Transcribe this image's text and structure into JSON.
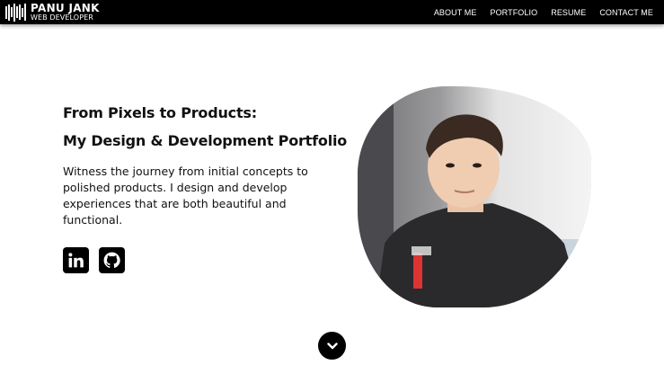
{
  "brand": {
    "name": "PANU JANK",
    "role": "WEB DEVELOPER",
    "logo_icon": "sound-bars-icon"
  },
  "nav": {
    "items": [
      {
        "label": "ABOUT ME"
      },
      {
        "label": "PORTFOLIO"
      },
      {
        "label": "RESUME"
      },
      {
        "label": "CONTACT ME"
      }
    ]
  },
  "hero": {
    "title_line1": "From Pixels to Products:",
    "title_line2": "My Design & Development Portfolio",
    "description": "Witness the journey from initial concepts to polished products. I design and develop experiences that are both beautiful and functional.",
    "social": [
      {
        "icon": "linkedin-icon"
      },
      {
        "icon": "github-icon"
      }
    ],
    "photo_icon": "profile-photo"
  },
  "scroll": {
    "icon": "chevron-down-icon"
  },
  "colors": {
    "navbar_bg": "#000000",
    "text": "#111111",
    "page_bg": "#ffffff"
  }
}
